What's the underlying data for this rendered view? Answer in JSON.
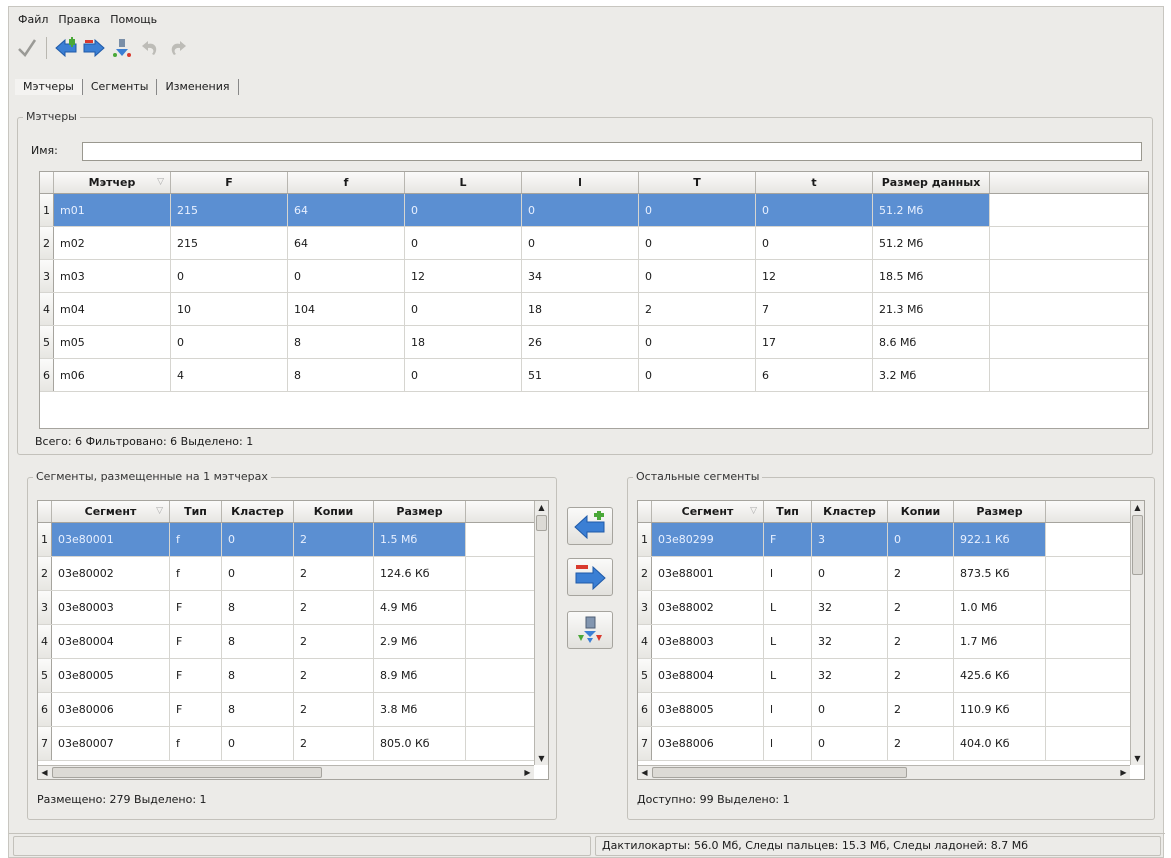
{
  "menu": {
    "items": [
      "Файл",
      "Правка",
      "Помощь"
    ]
  },
  "toolbar": {
    "icons": [
      "check-icon",
      "arrow-left-icon",
      "arrow-right-icon",
      "merge-down-icon",
      "undo-icon",
      "redo-icon"
    ]
  },
  "tabs": [
    {
      "label": "Мэтчеры",
      "active": true
    },
    {
      "label": "Сегменты",
      "active": false
    },
    {
      "label": "Изменения",
      "active": false
    }
  ],
  "matchers": {
    "group_title": "Мэтчеры",
    "name_label": "Имя:",
    "name_value": "",
    "columns": [
      "Мэтчер",
      "F",
      "f",
      "L",
      "l",
      "T",
      "t",
      "Размер данных"
    ],
    "rows": [
      {
        "n": "1",
        "cells": [
          "m01",
          "215",
          "64",
          "0",
          "0",
          "0",
          "0",
          "51.2 Мб"
        ],
        "selected": true
      },
      {
        "n": "2",
        "cells": [
          "m02",
          "215",
          "64",
          "0",
          "0",
          "0",
          "0",
          "51.2 Мб"
        ],
        "selected": false
      },
      {
        "n": "3",
        "cells": [
          "m03",
          "0",
          "0",
          "12",
          "34",
          "0",
          "12",
          "18.5 Мб"
        ],
        "selected": false
      },
      {
        "n": "4",
        "cells": [
          "m04",
          "10",
          "104",
          "0",
          "18",
          "2",
          "7",
          "21.3 Мб"
        ],
        "selected": false
      },
      {
        "n": "5",
        "cells": [
          "m05",
          "0",
          "8",
          "18",
          "26",
          "0",
          "17",
          "8.6 Мб"
        ],
        "selected": false
      },
      {
        "n": "6",
        "cells": [
          "m06",
          "4",
          "8",
          "0",
          "51",
          "0",
          "6",
          "3.2 Мб"
        ],
        "selected": false
      }
    ],
    "summary": "Всего: 6  Фильтровано: 6  Выделено: 1"
  },
  "placed_segments": {
    "group_title": "Сегменты, размещенные на 1 мэтчерах",
    "columns": [
      "Сегмент",
      "Тип",
      "Кластер",
      "Копии",
      "Размер"
    ],
    "rows": [
      {
        "n": "1",
        "cells": [
          "03e80001",
          "f",
          "0",
          "2",
          "1.5 Мб"
        ],
        "selected": true
      },
      {
        "n": "2",
        "cells": [
          "03e80002",
          "f",
          "0",
          "2",
          "124.6 Кб"
        ],
        "selected": false
      },
      {
        "n": "3",
        "cells": [
          "03e80003",
          "F",
          "8",
          "2",
          "4.9 Мб"
        ],
        "selected": false
      },
      {
        "n": "4",
        "cells": [
          "03e80004",
          "F",
          "8",
          "2",
          "2.9 Мб"
        ],
        "selected": false
      },
      {
        "n": "5",
        "cells": [
          "03e80005",
          "F",
          "8",
          "2",
          "8.9 Мб"
        ],
        "selected": false
      },
      {
        "n": "6",
        "cells": [
          "03e80006",
          "F",
          "8",
          "2",
          "3.8 Мб"
        ],
        "selected": false
      },
      {
        "n": "7",
        "cells": [
          "03e80007",
          "f",
          "0",
          "2",
          "805.0 Кб"
        ],
        "selected": false
      }
    ],
    "summary": "Размещено: 279   Выделено: 1"
  },
  "other_segments": {
    "group_title": "Остальные сегменты",
    "columns": [
      "Сегмент",
      "Тип",
      "Кластер",
      "Копии",
      "Размер"
    ],
    "rows": [
      {
        "n": "1",
        "cells": [
          "03e80299",
          "F",
          "3",
          "0",
          "922.1 Кб"
        ],
        "selected": true
      },
      {
        "n": "2",
        "cells": [
          "03e88001",
          "l",
          "0",
          "2",
          "873.5 Кб"
        ],
        "selected": false
      },
      {
        "n": "3",
        "cells": [
          "03e88002",
          "L",
          "32",
          "2",
          "1.0 Мб"
        ],
        "selected": false
      },
      {
        "n": "4",
        "cells": [
          "03e88003",
          "L",
          "32",
          "2",
          "1.7 Мб"
        ],
        "selected": false
      },
      {
        "n": "5",
        "cells": [
          "03e88004",
          "L",
          "32",
          "2",
          "425.6 Кб"
        ],
        "selected": false
      },
      {
        "n": "6",
        "cells": [
          "03e88005",
          "l",
          "0",
          "2",
          "110.9 Кб"
        ],
        "selected": false
      },
      {
        "n": "7",
        "cells": [
          "03e88006",
          "l",
          "0",
          "2",
          "404.0 Кб"
        ],
        "selected": false
      }
    ],
    "summary": "Доступно: 99   Выделено: 1"
  },
  "middle_buttons": [
    "add-segment-icon",
    "remove-segment-icon",
    "distribute-icon"
  ],
  "status": {
    "text": "Дактилокарты: 56.0 Мб, Следы пальцев: 15.3 Мб, Следы ладоней: 8.7 Мб"
  },
  "colors": {
    "selection": "#5b8fd2",
    "window_bg": "#ecebe8",
    "arrow_blue": "#3b7fd4",
    "arrow_green": "#4aa838",
    "arrow_red": "#d93a2e"
  }
}
